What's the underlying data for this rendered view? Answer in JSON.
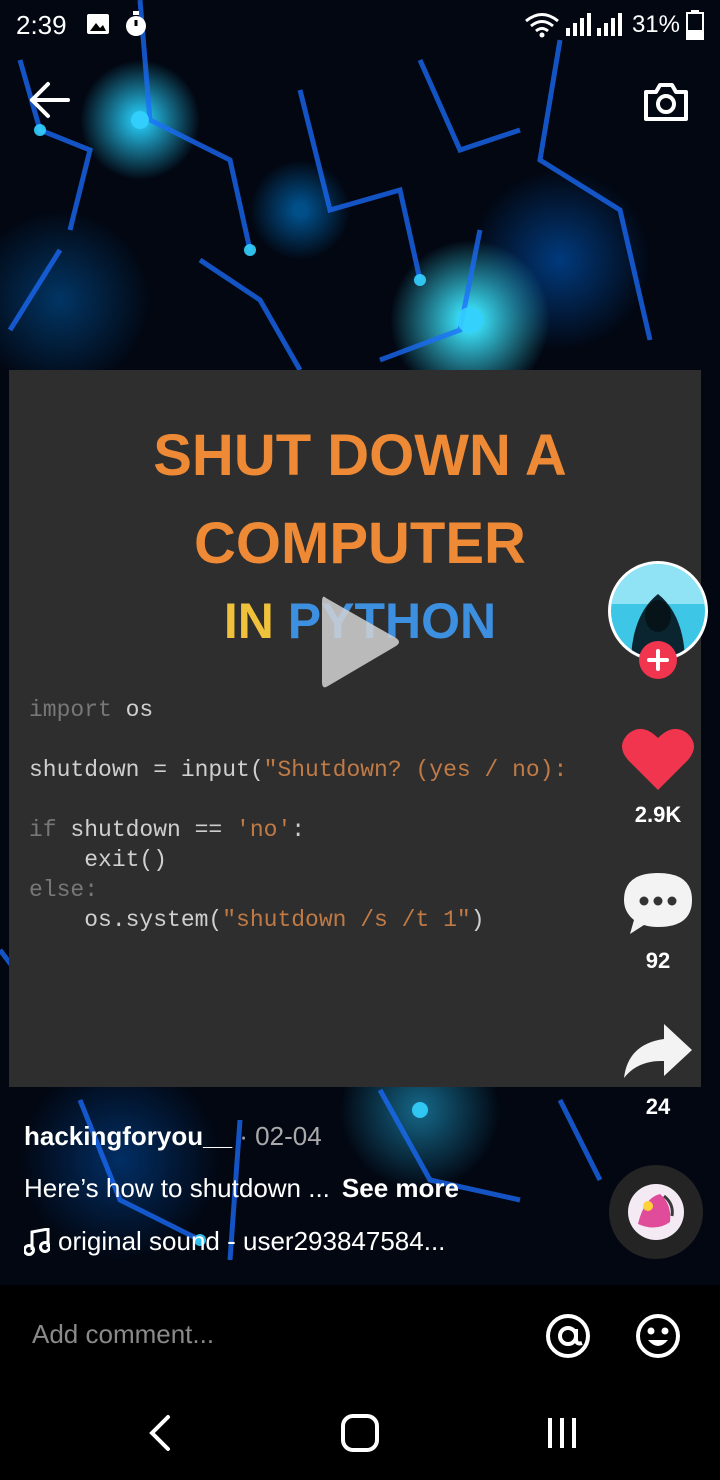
{
  "status_bar": {
    "time": "2:39",
    "battery": "31%"
  },
  "video": {
    "title_line1": "SHUT DOWN A",
    "title_line2": "COMPUTER",
    "title_in": "IN",
    "title_python": "PYTHON",
    "code": {
      "line1_kw": "import",
      "line1_rest": " os",
      "line2_a": "shutdown = input(",
      "line2_str": "\"Shutdown? (yes / no):",
      "line3_kw": "if",
      "line3_a": " shutdown == ",
      "line3_str": "'no'",
      "line3_b": ":",
      "line4": "    exit()",
      "line5_kw": "else:",
      "line6_a": "    os.system(",
      "line6_str": "\"shutdown /s /t 1\"",
      "line6_b": ")"
    }
  },
  "actions": {
    "likes": "2.9K",
    "comments": "92",
    "shares": "24"
  },
  "post": {
    "author": "hackingforyou__",
    "date": " · 02-04",
    "caption": "Here’s how to shutdown ...",
    "see_more": "See more",
    "sound": "original sound - user293847584..."
  },
  "comment_bar": {
    "placeholder": "Add comment..."
  },
  "colors": {
    "like": "#f1354f",
    "follow_plus": "#f1354f",
    "title_orange": "#ee8a36",
    "python_blue": "#3d8fe0",
    "python_yellow": "#f0c23b"
  }
}
